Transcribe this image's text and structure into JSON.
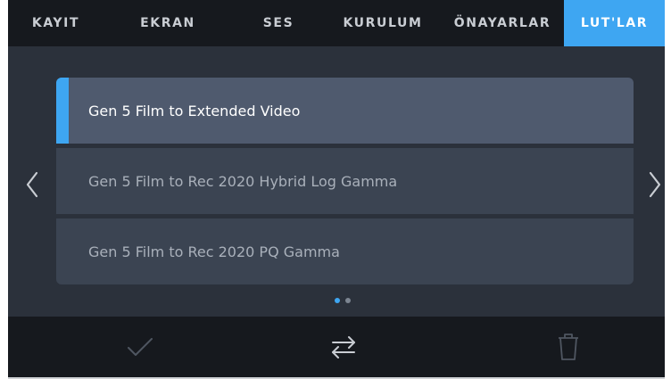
{
  "tabs": [
    {
      "label": "KAYIT",
      "active": false
    },
    {
      "label": "EKRAN",
      "active": false
    },
    {
      "label": "SES",
      "active": false
    },
    {
      "label": "KURULUM",
      "active": false
    },
    {
      "label": "ÖNAYARLAR",
      "active": false
    },
    {
      "label": "LUT'LAR",
      "active": true
    }
  ],
  "luts": [
    {
      "label": "Gen 5 Film to Extended Video",
      "selected": true
    },
    {
      "label": "Gen 5 Film to Rec 2020 Hybrid Log Gamma",
      "selected": false
    },
    {
      "label": "Gen 5 Film to Rec 2020 PQ Gamma",
      "selected": false
    }
  ],
  "pagination": {
    "pages": 2,
    "current": 1
  },
  "icons": {
    "prev": "chevron-left-icon",
    "next": "chevron-right-icon",
    "apply": "checkmark-icon",
    "swap": "swap-arrows-icon",
    "delete": "trash-icon"
  },
  "colors": {
    "accent": "#3ea6f2",
    "background": "#2b313b",
    "bar": "#16191e",
    "row": "#3b4452",
    "row_selected": "#4f5a6e"
  }
}
